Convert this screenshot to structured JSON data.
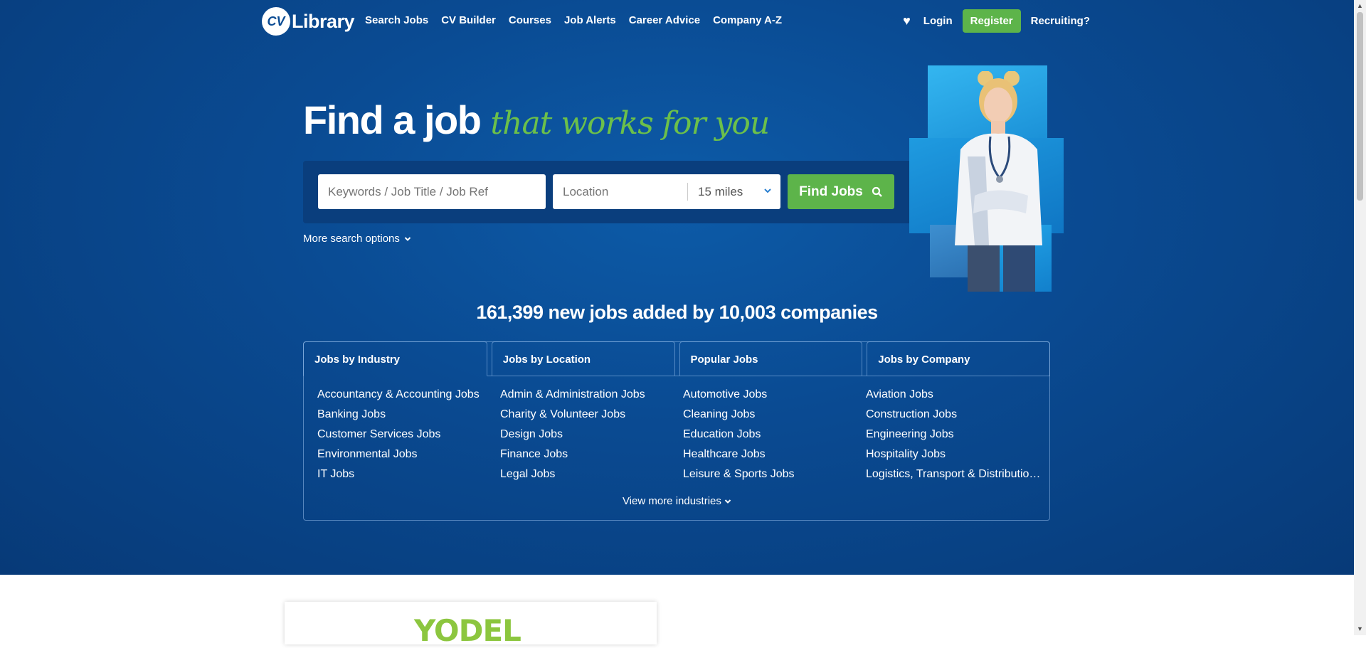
{
  "brand": {
    "logo_mark": "CV",
    "logo_text": "Library"
  },
  "nav": {
    "items": [
      "Search Jobs",
      "CV Builder",
      "Courses",
      "Job Alerts",
      "Career Advice",
      "Company A-Z"
    ],
    "login": "Login",
    "register": "Register",
    "recruiting": "Recruiting?"
  },
  "hero": {
    "headline": "Find a job",
    "headline_script": "that works for you"
  },
  "search": {
    "keywords_placeholder": "Keywords / Job Title / Job Ref",
    "location_placeholder": "Location",
    "radius": "15 miles",
    "find_button": "Find Jobs",
    "more_options": "More search options"
  },
  "stats": "161,399 new jobs added by 10,003 companies",
  "tabs": [
    "Jobs by Industry",
    "Jobs by Location",
    "Popular Jobs",
    "Jobs by Company"
  ],
  "industry_links": [
    "Accountancy & Accounting Jobs",
    "Admin & Administration Jobs",
    "Automotive Jobs",
    "Aviation Jobs",
    "Banking Jobs",
    "Charity & Volunteer Jobs",
    "Cleaning Jobs",
    "Construction Jobs",
    "Customer Services Jobs",
    "Design Jobs",
    "Education Jobs",
    "Engineering Jobs",
    "Environmental Jobs",
    "Finance Jobs",
    "Healthcare Jobs",
    "Hospitality Jobs",
    "IT Jobs",
    "Legal Jobs",
    "Leisure & Sports Jobs",
    "Logistics, Transport & Distribution Jobs"
  ],
  "view_more": "View more industries",
  "promo": {
    "logo_text": "YODEL"
  },
  "colors": {
    "hero_bg": "#0a4b93",
    "accent_green": "#5db44a",
    "script_green": "#6cc04a"
  }
}
